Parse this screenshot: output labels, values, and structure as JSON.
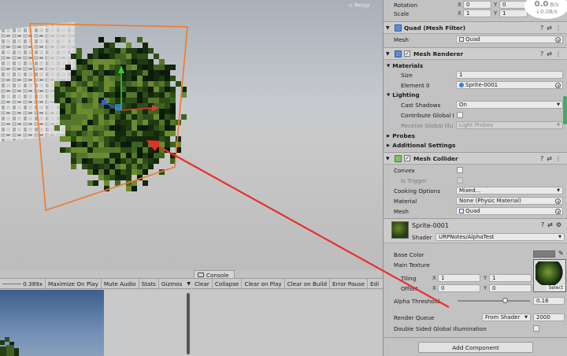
{
  "scene": {
    "persp_label": "< Persp"
  },
  "game_toolbar": {
    "scale_value": "0.389x",
    "maximize": "Maximize On Play",
    "mute": "Mute Audio",
    "stats": "Stats",
    "gizmos": "Gizmos"
  },
  "console": {
    "tab_label": "Console",
    "buttons": [
      "Clear",
      "Collapse",
      "Clear on Play",
      "Clear on Build",
      "Error Pause",
      "Edi"
    ]
  },
  "fps": {
    "main": "0.0",
    "unit": "B/s",
    "sub": "↓0.0B/s"
  },
  "inspector": {
    "transform": {
      "rotation_label": "Rotation",
      "rotation_x": "0",
      "rotation_y": "0",
      "scale_label": "Scale",
      "scale_x": "1",
      "scale_y": "1"
    },
    "mesh_filter": {
      "title": "Quad (Mesh Filter)",
      "mesh_label": "Mesh",
      "mesh_value": "Quad"
    },
    "mesh_renderer": {
      "title": "Mesh Renderer",
      "materials_label": "Materials",
      "size_label": "Size",
      "size_value": "1",
      "element0_label": "Element 0",
      "element0_value": "Sprite-0001",
      "lighting_label": "Lighting",
      "cast_shadows_label": "Cast Shadows",
      "cast_shadows_value": "On",
      "contribute_gi_label": "Contribute Global I",
      "receive_gi_label": "Receive Global Illu",
      "receive_gi_value": "Light Probes",
      "probes_label": "Probes",
      "additional_label": "Additional Settings"
    },
    "mesh_collider": {
      "title": "Mesh Collider",
      "convex_label": "Convex",
      "is_trigger_label": "Is Trigger",
      "cooking_label": "Cooking Options",
      "cooking_value": "Mixed...",
      "material_label": "Material",
      "material_value": "None (Physic Material)",
      "mesh_label": "Mesh",
      "mesh_value": "Quad"
    },
    "material": {
      "name": "Sprite-0001",
      "shader_label": "Shader",
      "shader_value": "URPNotes/AlphaTest",
      "base_color_label": "Base Color",
      "main_texture_label": "Main Texture",
      "tiling_label": "Tiling",
      "tiling_x": "1",
      "tiling_y": "1",
      "offset_label": "Offset",
      "offset_x": "0",
      "offset_y": "0",
      "select_label": "Select",
      "alpha_threshold_label": "Alpha Threshold",
      "alpha_threshold_value": "0.16",
      "alpha_threshold_fraction": 0.16,
      "render_queue_label": "Render Queue",
      "render_queue_mode": "From Shader",
      "render_queue_value": "2000",
      "double_sided_label": "Double Sided Global Illumination"
    },
    "add_component": "Add Component"
  },
  "colors": {
    "selection_orange": "#f07a28",
    "annotation_red": "#e8302a",
    "gizmo_y": "#2fcf2f",
    "gizmo_x": "#e23a2a",
    "gizmo_z": "#2f5fe0",
    "base_color": "#7c7c7c"
  }
}
